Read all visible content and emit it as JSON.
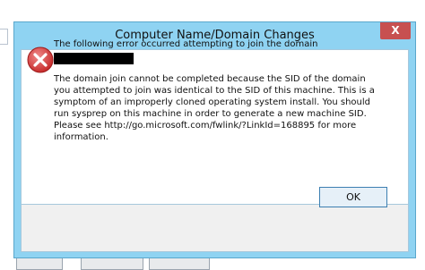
{
  "dialog": {
    "title": "Computer Name/Domain Changes",
    "close_label": "X",
    "heading": "The following error occurred attempting to join the domain",
    "body": "The domain join cannot be completed because the SID of the domain you attempted to join was identical to the SID of this machine. This is a symptom of an improperly cloned operating system install.  You should run sysprep on this machine in order to generate a new machine SID. Please see http://go.microsoft.com/fwlink/?LinkId=168895 for more information.",
    "ok_label": "OK",
    "icon": "error-icon"
  },
  "colors": {
    "frame": "#8fd3f2",
    "close_button": "#c75050",
    "error_red": "#d43a3a"
  }
}
